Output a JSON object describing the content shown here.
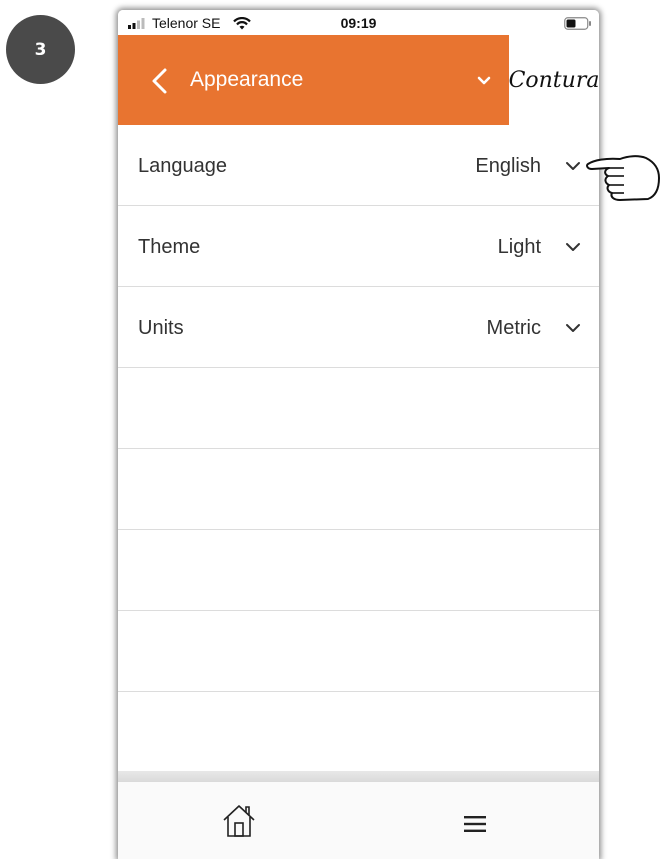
{
  "step_badge": "3",
  "status_bar": {
    "carrier": "Telenor SE",
    "time": "09:19",
    "icons": [
      "signal-icon",
      "wifi-icon",
      "battery-icon"
    ]
  },
  "header": {
    "title": "Appearance",
    "brand": "Contura",
    "icons": [
      "back-chevron-icon",
      "chevron-down-icon"
    ]
  },
  "settings": [
    {
      "label": "Language",
      "value": "English"
    },
    {
      "label": "Theme",
      "value": "Light"
    },
    {
      "label": "Units",
      "value": "Metric"
    }
  ],
  "empty_rows": 5,
  "bottom_nav": {
    "icons": [
      "home-icon",
      "hamburger-menu-icon"
    ]
  },
  "colors": {
    "header": "#e87430",
    "text": "#333333",
    "divider": "#dcdcdc",
    "badge": "#4a4a4a"
  },
  "annotation": {
    "icon": "pointing-hand-icon"
  }
}
